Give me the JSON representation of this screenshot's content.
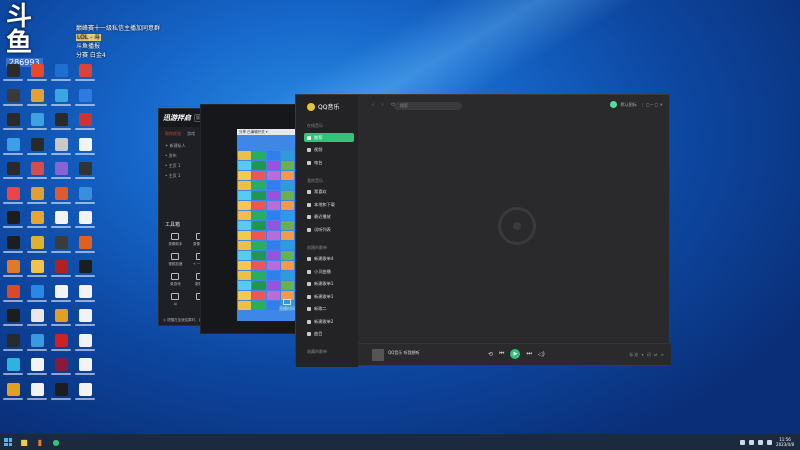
{
  "overlay": {
    "logo_text": "斗鱼",
    "room_number": "286993",
    "lines": [
      "巅峰赛十一级私信主播加同意群",
      "LOL - 斗",
      "斗鱼播报",
      "分赛 白金4"
    ]
  },
  "launcher": {
    "brand": "迅游拌启",
    "version": "版本 ▾",
    "tabs": [
      "帮你优化",
      "游戏",
      "开启版"
    ],
    "list": [
      "+ 新建私人",
      "• 发布",
      "• 主页 1",
      "• 主页 1"
    ],
    "tools_title": "工具箱",
    "tools": [
      "录像助手",
      "录像助手",
      "合击日志",
      "视频加速",
      "+ 一加速",
      "剧本解",
      "录游戏",
      "录像集",
      "合击助手",
      "Ai",
      "",
      ""
    ],
    "footer": "◎ 提醒在加速结果时，自从加速内容自动加速"
  },
  "midwin": {
    "header": "分享  已编辑开关 ▾",
    "share_label": "直播时间"
  },
  "qqmusic": {
    "app_name": "QQ音乐",
    "search_placeholder": "搜索",
    "nav_arrows": "‹ › ⟳",
    "user_name": "默认图标",
    "window_controls": "⋮ ▢ ─ ▢ ✕",
    "side_groups": [
      {
        "title": "在线音乐",
        "items": [
          "推荐",
          "视频",
          "电台"
        ]
      },
      {
        "title": "我的音乐",
        "items": [
          "我喜欢",
          "本地和下载",
          "最近播放",
          "试听列表"
        ]
      },
      {
        "title": "创建的歌单",
        "items": [
          "新建歌单4",
          "小贝曲播",
          "新建歌单1",
          "新建歌单1",
          "新歌二",
          "新建歌单2",
          "曲目"
        ]
      },
      {
        "title": "收藏的歌单",
        "items": []
      }
    ],
    "player": {
      "title": "QQ音乐  听我想听",
      "right_controls": "标准 ▾ 词 ⇄ ≡"
    }
  },
  "taskbar": {
    "time": "11:56",
    "date": "2023/4/8"
  },
  "colors": {
    "accent_green": "#31c27c",
    "launcher_red": "#d5472f"
  }
}
